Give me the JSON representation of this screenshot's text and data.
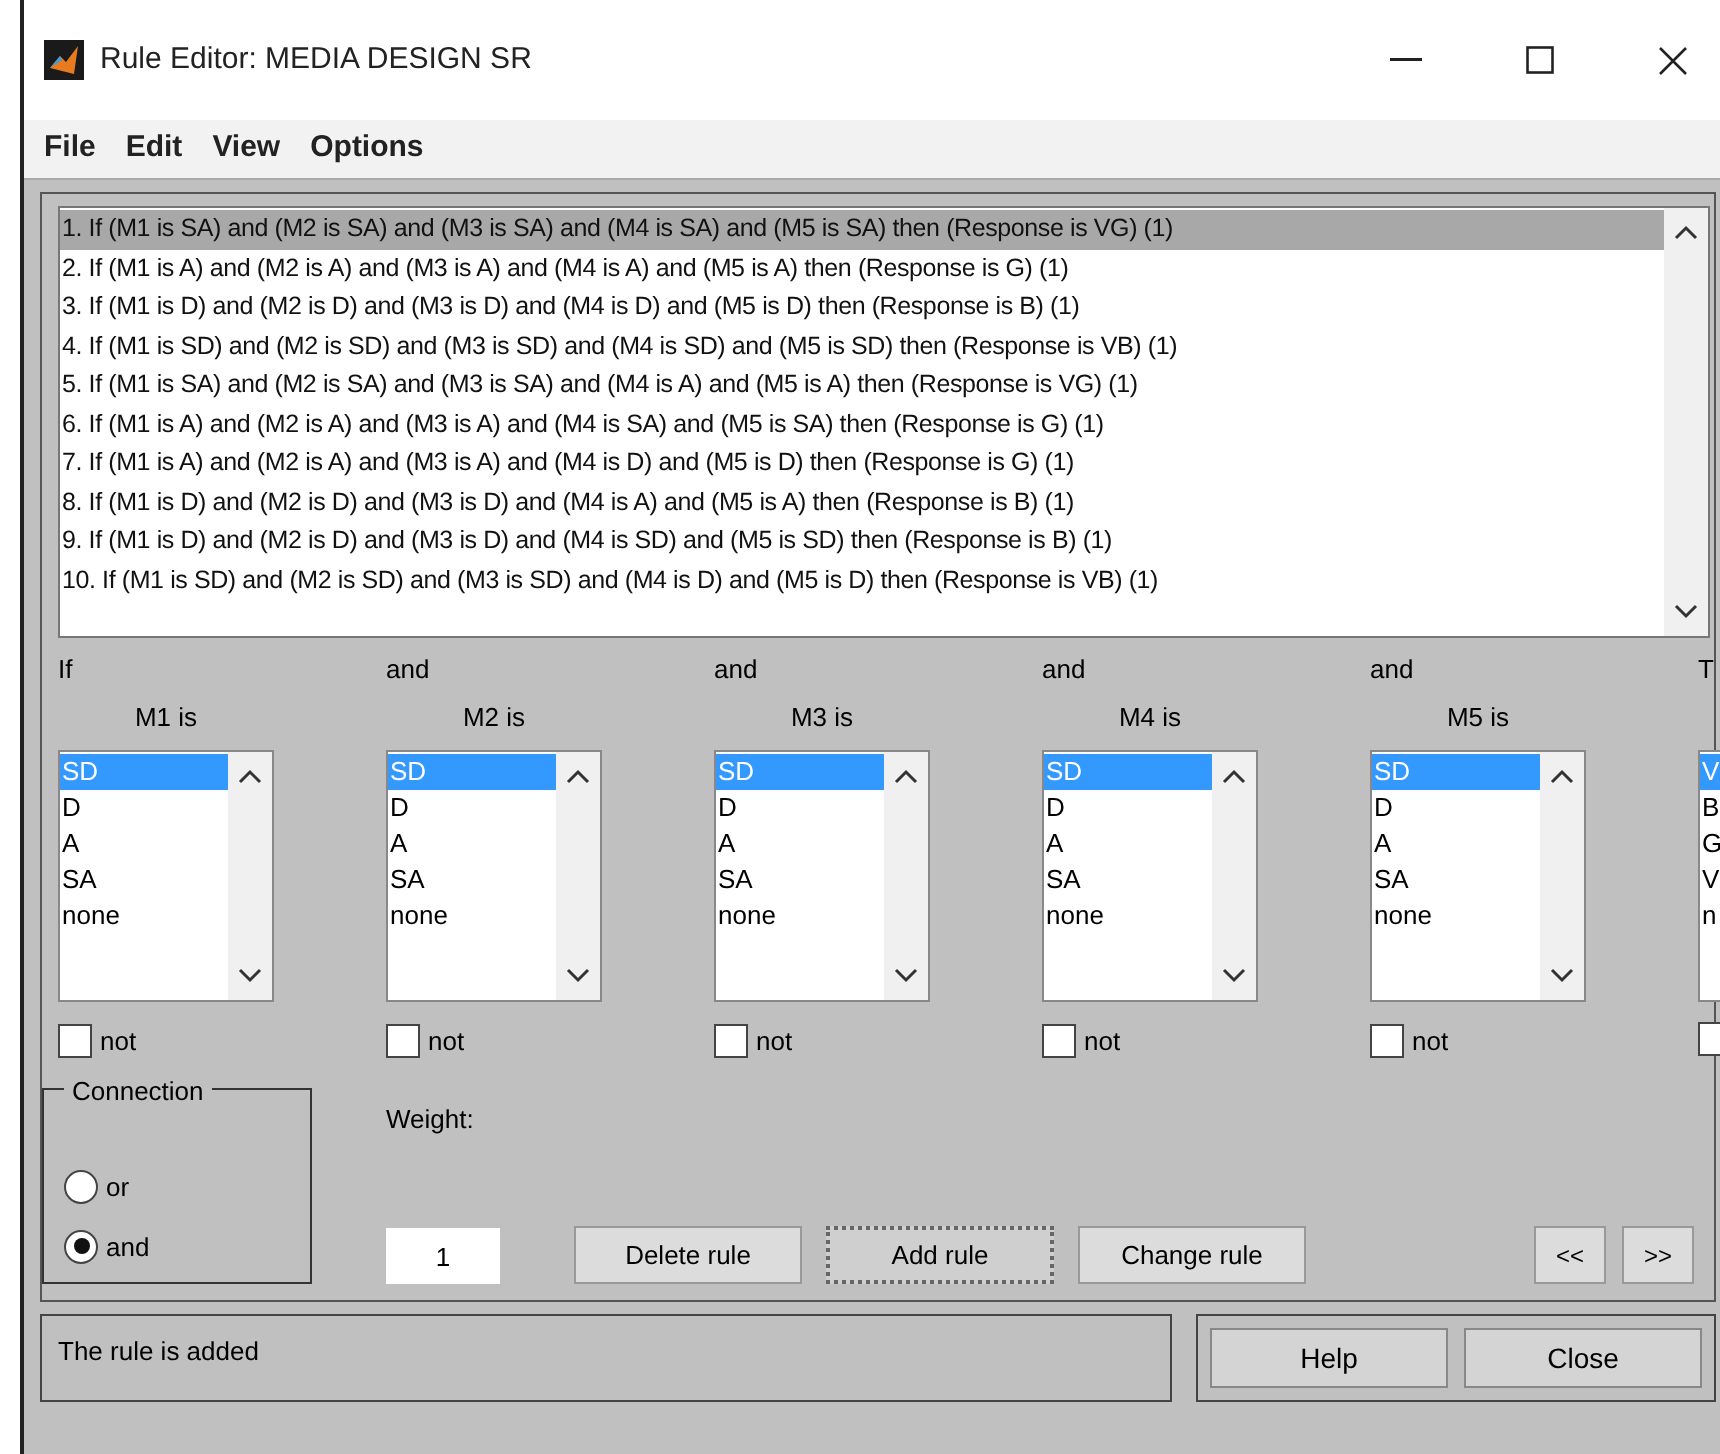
{
  "window": {
    "title": "Rule Editor: MEDIA DESIGN SR"
  },
  "menu": [
    "File",
    "Edit",
    "View",
    "Options"
  ],
  "rules": [
    {
      "text": "1. If (M1 is SA) and (M2 is SA) and (M3 is SA) and (M4 is SA) and (M5 is SA) then (Response is VG) (1)",
      "selected": true
    },
    {
      "text": "2. If (M1 is A) and (M2 is A) and (M3 is A) and (M4 is A) and (M5 is A) then (Response is G) (1)",
      "selected": false
    },
    {
      "text": "3. If (M1 is D) and (M2 is D) and (M3 is D) and (M4 is D) and (M5 is D) then (Response is B) (1)",
      "selected": false
    },
    {
      "text": "4. If (M1 is SD) and (M2 is SD) and (M3 is SD) and (M4 is SD) and (M5 is SD) then (Response is VB) (1)",
      "selected": false
    },
    {
      "text": "5. If (M1 is SA) and (M2 is SA) and (M3 is SA) and (M4 is A) and (M5 is A) then (Response is VG) (1)",
      "selected": false
    },
    {
      "text": "6. If (M1 is A) and (M2 is A) and (M3 is A) and (M4 is SA) and (M5 is SA) then (Response is G) (1)",
      "selected": false
    },
    {
      "text": "7. If (M1 is A) and (M2 is A) and (M3 is A) and (M4 is D) and (M5 is D) then (Response is G) (1)",
      "selected": false
    },
    {
      "text": "8. If (M1 is D) and (M2 is D) and (M3 is D) and (M4 is A) and (M5 is A) then (Response is B) (1)",
      "selected": false
    },
    {
      "text": "9. If (M1 is D) and (M2 is D) and (M3 is D) and (M4 is SD) and (M5 is SD) then (Response is B) (1)",
      "selected": false
    },
    {
      "text": "10. If (M1 is SD) and (M2 is SD) and (M3 is SD) and (M4 is D) and (M5 is D) then (Response is VB) (1)",
      "selected": false
    }
  ],
  "columns": [
    {
      "connector": "If",
      "variable": "M1 is",
      "options": [
        {
          "label": "SD",
          "selected": true
        },
        {
          "label": "D",
          "selected": false
        },
        {
          "label": "A",
          "selected": false
        },
        {
          "label": "SA",
          "selected": false
        },
        {
          "label": "none",
          "selected": false
        }
      ],
      "not": {
        "label": "not",
        "checked": false
      }
    },
    {
      "connector": "and",
      "variable": "M2 is",
      "options": [
        {
          "label": "SD",
          "selected": true
        },
        {
          "label": "D",
          "selected": false
        },
        {
          "label": "A",
          "selected": false
        },
        {
          "label": "SA",
          "selected": false
        },
        {
          "label": "none",
          "selected": false
        }
      ],
      "not": {
        "label": "not",
        "checked": false
      }
    },
    {
      "connector": "and",
      "variable": "M3 is",
      "options": [
        {
          "label": "SD",
          "selected": true
        },
        {
          "label": "D",
          "selected": false
        },
        {
          "label": "A",
          "selected": false
        },
        {
          "label": "SA",
          "selected": false
        },
        {
          "label": "none",
          "selected": false
        }
      ],
      "not": {
        "label": "not",
        "checked": false
      }
    },
    {
      "connector": "and",
      "variable": "M4 is",
      "options": [
        {
          "label": "SD",
          "selected": true
        },
        {
          "label": "D",
          "selected": false
        },
        {
          "label": "A",
          "selected": false
        },
        {
          "label": "SA",
          "selected": false
        },
        {
          "label": "none",
          "selected": false
        }
      ],
      "not": {
        "label": "not",
        "checked": false
      }
    },
    {
      "connector": "and",
      "variable": "M5 is",
      "options": [
        {
          "label": "SD",
          "selected": true
        },
        {
          "label": "D",
          "selected": false
        },
        {
          "label": "A",
          "selected": false
        },
        {
          "label": "SA",
          "selected": false
        },
        {
          "label": "none",
          "selected": false
        }
      ],
      "not": {
        "label": "not",
        "checked": false
      }
    },
    {
      "connector": "T",
      "options": [
        {
          "label": "V",
          "selected": true
        },
        {
          "label": "B",
          "selected": false
        },
        {
          "label": "G",
          "selected": false
        },
        {
          "label": "V",
          "selected": false
        },
        {
          "label": "n",
          "selected": false
        }
      ],
      "not": {
        "checked": false
      }
    }
  ],
  "connection": {
    "title": "Connection",
    "options": [
      {
        "label": "or",
        "selected": false
      },
      {
        "label": "and",
        "selected": true
      }
    ]
  },
  "weight": {
    "label": "Weight:",
    "value": "1"
  },
  "rule_buttons": [
    {
      "label": "Delete rule",
      "focused": false
    },
    {
      "label": "Add rule",
      "focused": true
    },
    {
      "label": "Change rule",
      "focused": false
    }
  ],
  "nav_buttons": [
    "<<",
    ">>"
  ],
  "status": "The rule is added",
  "footer_buttons": [
    "Help",
    "Close"
  ]
}
